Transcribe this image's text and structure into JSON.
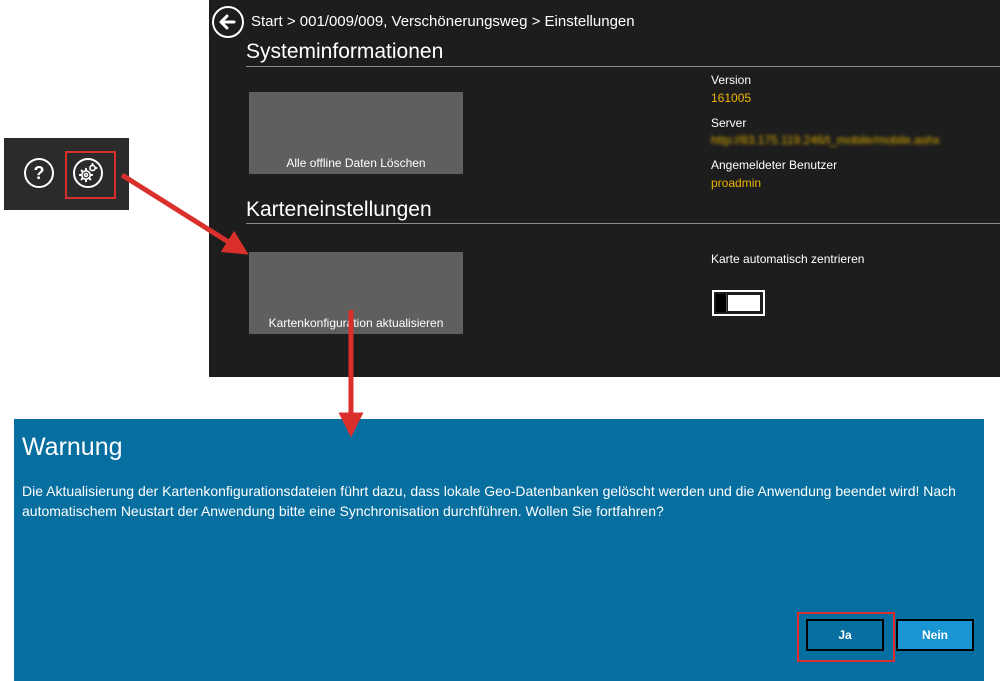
{
  "mini_toolbar": {
    "help_glyph": "?",
    "help_icon": "help-icon",
    "settings_icon": "gear-icon"
  },
  "settings": {
    "breadcrumb": "Start > 001/009/009, Verschönerungsweg > Einstellungen",
    "system_section_title": "Systeminformationen",
    "delete_offline_label": "Alle offline Daten Löschen",
    "version_label": "Version",
    "version_value": "161005",
    "server_label": "Server",
    "server_value": "http://83.175.119.246/t_mobile/mobile.ashx",
    "user_label": "Angemeldeter Benutzer",
    "user_value": "proadmin",
    "map_section_title": "Karteneinstellungen",
    "update_config_label": "Kartenkonfiguration aktualisieren",
    "auto_center_label": "Karte automatisch zentrieren",
    "auto_center_on": false
  },
  "dialog": {
    "title": "Warnung",
    "message": "Die Aktualisierung der Kartenkonfigurationsdateien führt dazu, dass lokale Geo-Datenbanken gelöscht werden und die Anwendung beendet wird! Nach automatischem Neustart der Anwendung bitte eine Synchronisation durchführen. Wollen Sie fortfahren?",
    "yes_label": "Ja",
    "no_label": "Nein"
  },
  "colors": {
    "accent_value": "#f0b400",
    "dialog_bg": "#076fa0",
    "annotation_red": "#d9302c"
  }
}
